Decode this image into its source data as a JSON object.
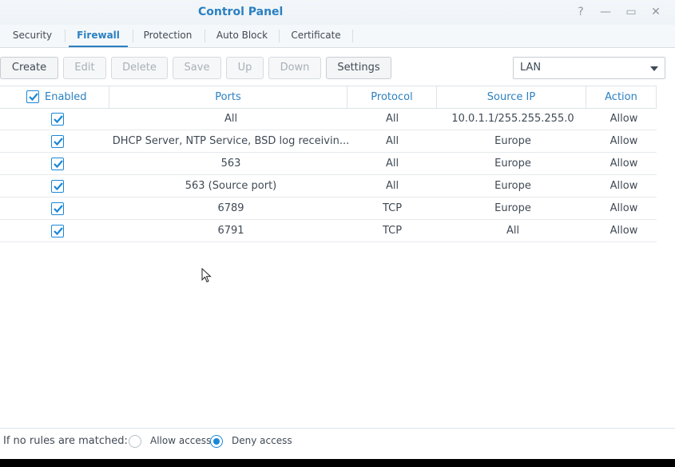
{
  "window": {
    "title": "Control Panel",
    "controls": {
      "help": "?",
      "minimize": "—",
      "maximize": "▭",
      "close": "✕"
    }
  },
  "tabs": [
    {
      "label": "Security",
      "active": false
    },
    {
      "label": "Firewall",
      "active": true
    },
    {
      "label": "Protection",
      "active": false
    },
    {
      "label": "Auto Block",
      "active": false
    },
    {
      "label": "Certificate",
      "active": false
    }
  ],
  "toolbar": {
    "create": "Create",
    "edit": "Edit",
    "delete": "Delete",
    "save": "Save",
    "up": "Up",
    "down": "Down",
    "settings": "Settings",
    "interface_select": "LAN"
  },
  "table": {
    "columns": [
      "Enabled",
      "Ports",
      "Protocol",
      "Source IP",
      "Action"
    ],
    "rows": [
      {
        "enabled": true,
        "ports": "All",
        "protocol": "All",
        "source_ip": "10.0.1.1/255.255.255.0",
        "action": "Allow"
      },
      {
        "enabled": true,
        "ports": "DHCP Server, NTP Service, BSD log receivin...",
        "protocol": "All",
        "source_ip": "Europe",
        "action": "Allow"
      },
      {
        "enabled": true,
        "ports": "563",
        "protocol": "All",
        "source_ip": "Europe",
        "action": "Allow"
      },
      {
        "enabled": true,
        "ports": "563 (Source port)",
        "protocol": "All",
        "source_ip": "Europe",
        "action": "Allow"
      },
      {
        "enabled": true,
        "ports": "6789",
        "protocol": "TCP",
        "source_ip": "Europe",
        "action": "Allow"
      },
      {
        "enabled": true,
        "ports": "6791",
        "protocol": "TCP",
        "source_ip": "All",
        "action": "Allow"
      }
    ]
  },
  "footer": {
    "label": "If no rules are matched:",
    "allow_label": "Allow access",
    "deny_label": "Deny access",
    "selected": "deny"
  },
  "colors": {
    "accent": "#2b80c2",
    "checkbox": "#1a87d7"
  }
}
